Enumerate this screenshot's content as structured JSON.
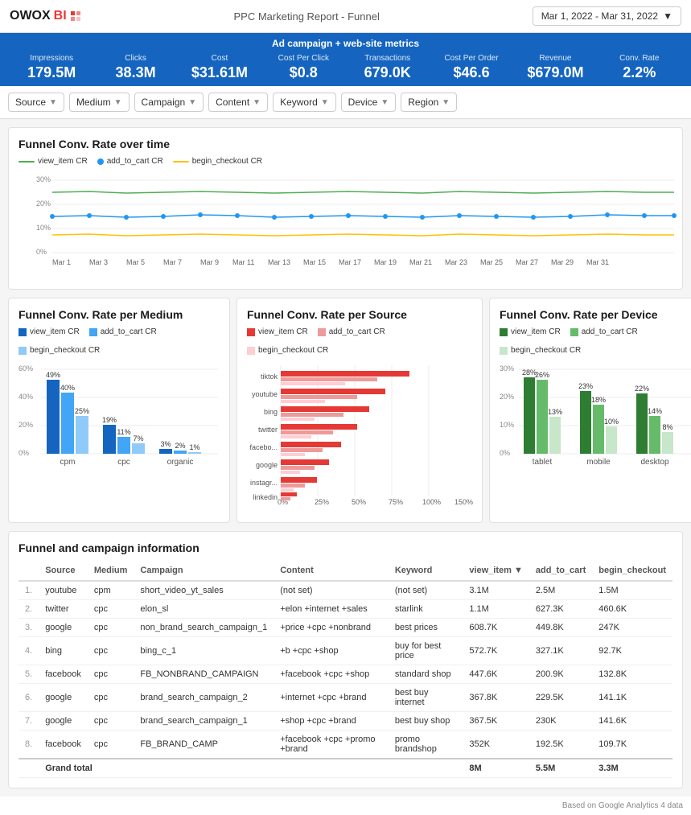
{
  "header": {
    "logo": "OWOX",
    "logo_bi": "BI",
    "title": "PPC Marketing Report - Funnel",
    "date_range": "Mar 1, 2022 - Mar 31, 2022"
  },
  "metrics_banner": {
    "title": "Ad campaign + web-site metrics",
    "metrics": [
      {
        "label": "Impressions",
        "value": "179.5M"
      },
      {
        "label": "Clicks",
        "value": "38.3M"
      },
      {
        "label": "Cost",
        "value": "$31.61M"
      },
      {
        "label": "Cost Per Click",
        "value": "$0.8"
      },
      {
        "label": "Transactions",
        "value": "679.0K"
      },
      {
        "label": "Cost Per Order",
        "value": "$46.6"
      },
      {
        "label": "Revenue",
        "value": "$679.0M"
      },
      {
        "label": "Conv. Rate",
        "value": "2.2%"
      }
    ]
  },
  "filters": [
    {
      "label": "Source"
    },
    {
      "label": "Medium"
    },
    {
      "label": "Campaign"
    },
    {
      "label": "Content"
    },
    {
      "label": "Keyword"
    },
    {
      "label": "Device"
    },
    {
      "label": "Region"
    }
  ],
  "funnel_time": {
    "title": "Funnel Conv. Rate over time",
    "legend": [
      {
        "key": "view_item_cr",
        "label": "view_item CR",
        "color": "#4caf50"
      },
      {
        "key": "add_to_cart_cr",
        "label": "add_to_cart CR",
        "color": "#2196f3"
      },
      {
        "key": "begin_checkout_cr",
        "label": "begin_checkout CR",
        "color": "#ffc107"
      }
    ]
  },
  "funnel_medium": {
    "title": "Funnel Conv. Rate per Medium",
    "legend": [
      {
        "label": "view_item CR",
        "color": "#1565c0"
      },
      {
        "label": "add_to_cart CR",
        "color": "#42a5f5"
      },
      {
        "label": "begin_checkout CR",
        "color": "#90caf9"
      }
    ],
    "groups": [
      "cpm",
      "cpc",
      "organic"
    ],
    "data": {
      "cpm": [
        49,
        40,
        25
      ],
      "cpc": [
        19,
        11,
        7
      ],
      "organic": [
        3,
        2,
        1
      ]
    }
  },
  "funnel_source": {
    "title": "Funnel Conv. Rate per Source",
    "legend": [
      {
        "label": "view_item CR",
        "color": "#e53935"
      },
      {
        "label": "add_to_cart CR",
        "color": "#ef9a9a"
      },
      {
        "label": "begin_checkout CR",
        "color": "#ffcdd2"
      }
    ],
    "sources": [
      "tiktok",
      "youtube",
      "bing",
      "twitter",
      "facebo...",
      "google",
      "instagr...",
      "linkedin"
    ]
  },
  "funnel_device": {
    "title": "Funnel Conv. Rate per Device",
    "legend": [
      {
        "label": "view_item CR",
        "color": "#2e7d32"
      },
      {
        "label": "add_to_cart CR",
        "color": "#66bb6a"
      },
      {
        "label": "begin_checkout CR",
        "color": "#c8e6c9"
      }
    ],
    "groups": [
      "tablet",
      "mobile",
      "desktop"
    ],
    "data": {
      "tablet": [
        28,
        26,
        13
      ],
      "mobile": [
        23,
        18,
        10
      ],
      "desktop": [
        22,
        14,
        8
      ]
    }
  },
  "table": {
    "title": "Funnel and campaign information",
    "columns": [
      "Source",
      "Medium",
      "Campaign",
      "Content",
      "Keyword",
      "view_item ▼",
      "add_to_cart",
      "begin_checkout"
    ],
    "rows": [
      {
        "num": "1.",
        "source": "youtube",
        "medium": "cpm",
        "campaign": "short_video_yt_sales",
        "content": "(not set)",
        "keyword": "(not set)",
        "view_item": "3.1M",
        "add_to_cart": "2.5M",
        "begin_checkout": "1.5M"
      },
      {
        "num": "2.",
        "source": "twitter",
        "medium": "cpc",
        "campaign": "elon_sl",
        "content": "+elon +internet +sales",
        "keyword": "starlink",
        "view_item": "1.1M",
        "add_to_cart": "627.3K",
        "begin_checkout": "460.6K"
      },
      {
        "num": "3.",
        "source": "google",
        "medium": "cpc",
        "campaign": "non_brand_search_campaign_1",
        "content": "+price +cpc +nonbrand",
        "keyword": "best prices",
        "view_item": "608.7K",
        "add_to_cart": "449.8K",
        "begin_checkout": "247K"
      },
      {
        "num": "4.",
        "source": "bing",
        "medium": "cpc",
        "campaign": "bing_c_1",
        "content": "+b +cpc +shop",
        "keyword": "buy for best price",
        "view_item": "572.7K",
        "add_to_cart": "327.1K",
        "begin_checkout": "92.7K"
      },
      {
        "num": "5.",
        "source": "facebook",
        "medium": "cpc",
        "campaign": "FB_NONBRAND_CAMPAIGN",
        "content": "+facebook +cpc +shop",
        "keyword": "standard shop",
        "view_item": "447.6K",
        "add_to_cart": "200.9K",
        "begin_checkout": "132.8K"
      },
      {
        "num": "6.",
        "source": "google",
        "medium": "cpc",
        "campaign": "brand_search_campaign_2",
        "content": "+internet +cpc +brand",
        "keyword": "best buy internet",
        "view_item": "367.8K",
        "add_to_cart": "229.5K",
        "begin_checkout": "141.1K"
      },
      {
        "num": "7.",
        "source": "google",
        "medium": "cpc",
        "campaign": "brand_search_campaign_1",
        "content": "+shop +cpc +brand",
        "keyword": "best buy shop",
        "view_item": "367.5K",
        "add_to_cart": "230K",
        "begin_checkout": "141.6K"
      },
      {
        "num": "8.",
        "source": "facebook",
        "medium": "cpc",
        "campaign": "FB_BRAND_CAMP",
        "content": "+facebook +cpc +promo +brand",
        "keyword": "promo brandshop",
        "view_item": "352K",
        "add_to_cart": "192.5K",
        "begin_checkout": "109.7K"
      }
    ],
    "grand_total": {
      "label": "Grand total",
      "view_item": "8M",
      "add_to_cart": "5.5M",
      "begin_checkout": "3.3M"
    }
  },
  "footer": {
    "note": "Based on Google Analytics 4 data"
  }
}
